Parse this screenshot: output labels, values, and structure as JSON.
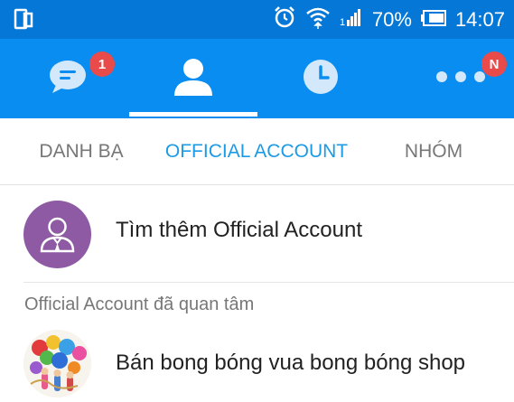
{
  "status_bar": {
    "battery_percent": "70%",
    "time": "14:07",
    "icons": [
      "phone-rotate-icon",
      "alarm-icon",
      "wifi-icon",
      "signal-icon",
      "battery-icon"
    ]
  },
  "nav": {
    "items": [
      {
        "name": "messages",
        "icon": "chat-bubble-icon",
        "badge": "1"
      },
      {
        "name": "contacts",
        "icon": "person-icon",
        "selected": true
      },
      {
        "name": "timeline",
        "icon": "clock-icon"
      },
      {
        "name": "more",
        "icon": "more-dots-icon",
        "badge": "N"
      }
    ],
    "colors": {
      "bar": "#0a8df0",
      "badge": "#e94b4b"
    }
  },
  "tabs": [
    {
      "label": "DANH BẠ"
    },
    {
      "label": "OFFICIAL ACCOUNT",
      "selected": true
    },
    {
      "label": "NHÓM"
    }
  ],
  "find": {
    "label": "Tìm thêm Official Account",
    "icon": "official-account-icon"
  },
  "section_header": "Official Account đã quan tâm",
  "official_accounts": [
    {
      "name": "Bán bong bóng vua bong bóng shop"
    }
  ],
  "colors": {
    "accent": "#1b9be6",
    "status_bar": "#0577d6",
    "purple": "#8e5aa3"
  }
}
